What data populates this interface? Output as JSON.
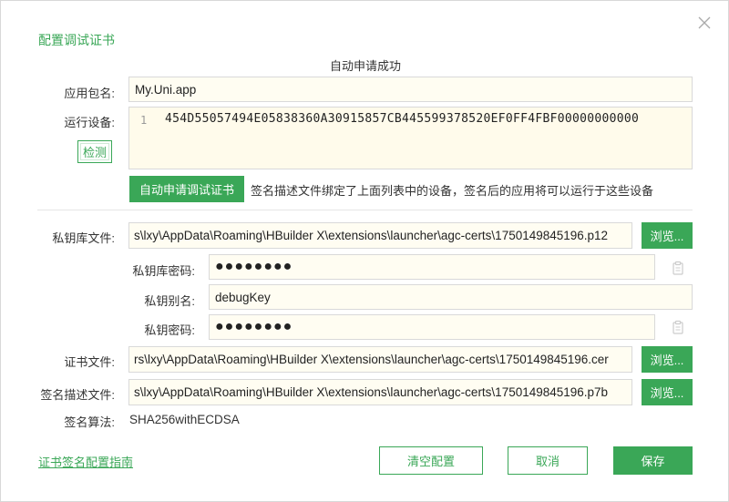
{
  "dialog": {
    "title": "配置调试证书",
    "status": "自动申请成功"
  },
  "package": {
    "label": "应用包名:",
    "value": "My.Uni.app"
  },
  "device": {
    "label": "运行设备:",
    "detect_label": "检测",
    "line_number": "1",
    "device_id": "454D55057494E05838360A30915857CB445599378520EF0FF4FBF00000000000"
  },
  "auto_apply": {
    "button_label": "自动申请调试证书",
    "hint": "签名描述文件绑定了上面列表中的设备，签名后的应用将可以运行于这些设备"
  },
  "keystore": {
    "label": "私钥库文件:",
    "value": "s\\lxy\\AppData\\Roaming\\HBuilder X\\extensions\\launcher\\agc-certs\\1750149845196.p12",
    "browse_label": "浏览..."
  },
  "keystore_password": {
    "label": "私钥库密码:",
    "value": "●●●●●●●●"
  },
  "key_alias": {
    "label": "私钥别名:",
    "value": "debugKey"
  },
  "key_password": {
    "label": "私钥密码:",
    "value": "●●●●●●●●"
  },
  "certificate": {
    "label": "证书文件:",
    "value": "rs\\lxy\\AppData\\Roaming\\HBuilder X\\extensions\\launcher\\agc-certs\\1750149845196.cer",
    "browse_label": "浏览..."
  },
  "profile": {
    "label": "签名描述文件:",
    "value": "s\\lxy\\AppData\\Roaming\\HBuilder X\\extensions\\launcher\\agc-certs\\1750149845196.p7b",
    "browse_label": "浏览..."
  },
  "algorithm": {
    "label": "签名算法:",
    "value": "SHA256withECDSA"
  },
  "footer": {
    "guide_link": "证书签名配置指南",
    "clear_label": "清空配置",
    "cancel_label": "取消",
    "save_label": "保存"
  },
  "colors": {
    "accent": "#3aa757",
    "input_bg": "#fffdf2",
    "border": "#d9d9d9"
  },
  "icons": {
    "close": "close-icon",
    "paste": "clipboard-icon"
  }
}
